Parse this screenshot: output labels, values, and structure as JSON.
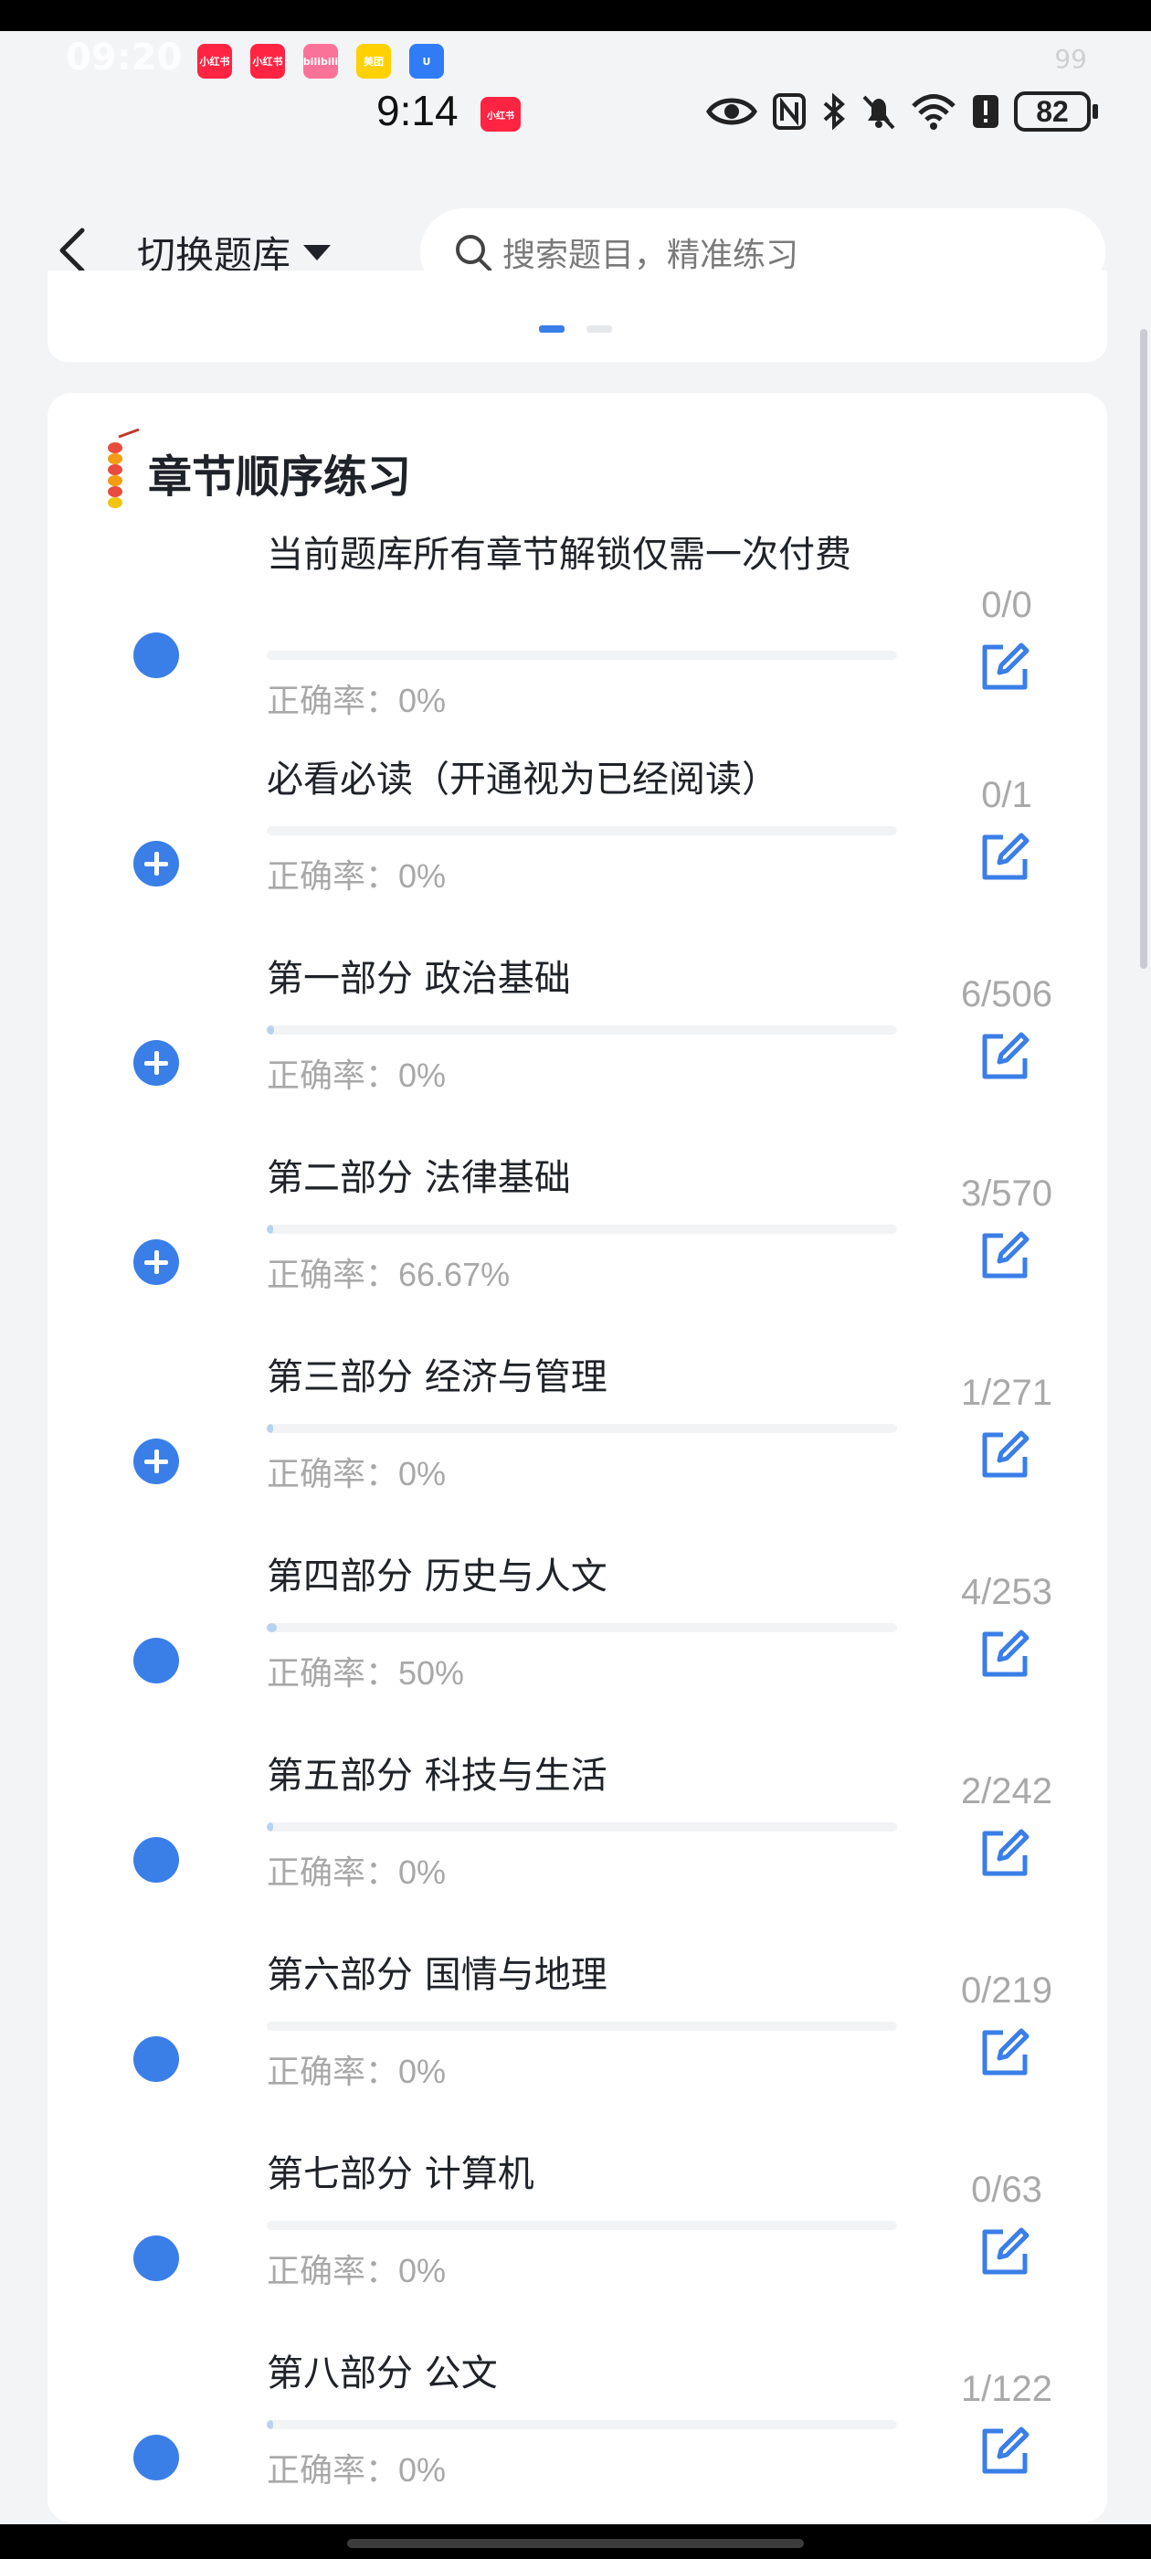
{
  "ghost_status": {
    "time": "09:20",
    "apps": [
      {
        "label": "小红书",
        "color": "#ff2442"
      },
      {
        "label": "小红书",
        "color": "#ff2442"
      },
      {
        "label": "bilibili",
        "color": "#fb7299"
      },
      {
        "label": "美团",
        "color": "#ffd100"
      },
      {
        "label": "U",
        "color": "#2f7cf6"
      }
    ],
    "battery": "99"
  },
  "statusbar": {
    "time": "9:14",
    "notification_badge": "小红书",
    "battery": "82",
    "icons": [
      "eye-icon",
      "nfc-icon",
      "bluetooth-icon",
      "bell-off-icon",
      "wifi-icon",
      "alert-icon"
    ]
  },
  "header": {
    "back_label": "<",
    "switch_label": "切换题库",
    "search_placeholder": "搜索题目，精准练习"
  },
  "section": {
    "title": "章节顺序练习"
  },
  "accuracy_label": "正确率：",
  "chapters": [
    {
      "title": "当前题库所有章节解锁仅需一次付费",
      "count": "0/0",
      "accuracy": "0%",
      "progress": 0,
      "expandable": false
    },
    {
      "title": "必看必读（开通视为已经阅读）",
      "count": "0/1",
      "accuracy": "0%",
      "progress": 0,
      "expandable": true
    },
    {
      "title": "第一部分 政治基础",
      "count": "6/506",
      "accuracy": "0%",
      "progress": 0.012,
      "expandable": true
    },
    {
      "title": "第二部分 法律基础",
      "count": "3/570",
      "accuracy": "66.67%",
      "progress": 0.005,
      "expandable": true
    },
    {
      "title": "第三部分 经济与管理",
      "count": "1/271",
      "accuracy": "0%",
      "progress": 0.004,
      "expandable": true
    },
    {
      "title": "第四部分 历史与人文",
      "count": "4/253",
      "accuracy": "50%",
      "progress": 0.016,
      "expandable": false
    },
    {
      "title": "第五部分 科技与生活",
      "count": "2/242",
      "accuracy": "0%",
      "progress": 0.008,
      "expandable": false
    },
    {
      "title": "第六部分 国情与地理",
      "count": "0/219",
      "accuracy": "0%",
      "progress": 0,
      "expandable": false
    },
    {
      "title": "第七部分 计算机",
      "count": "0/63",
      "accuracy": "0%",
      "progress": 0,
      "expandable": false
    },
    {
      "title": "第八部分 公文",
      "count": "1/122",
      "accuracy": "0%",
      "progress": 0.008,
      "expandable": false
    }
  ],
  "colors": {
    "accent": "#3a7ee8",
    "progress_fill": "#b8d3ef",
    "muted_text": "#a8a8a8"
  }
}
